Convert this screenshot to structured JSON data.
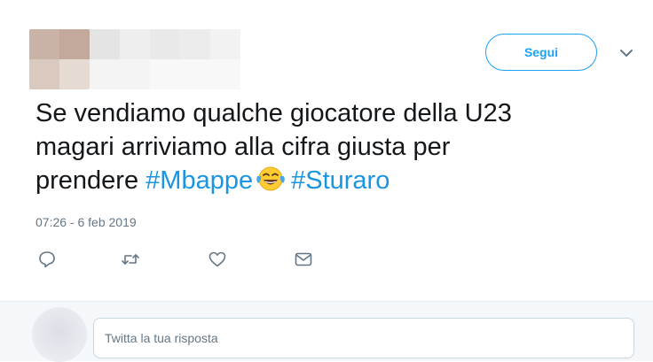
{
  "tweet": {
    "follow_label": "Segui",
    "text_line1": "Se vendiamo qualche giocatore della U23",
    "text_line2": "magari arriviamo alla cifra giusta per",
    "text_line3_prefix": "prendere ",
    "hashtag1": "#Mbappe",
    "emoji": "face-with-tears-of-joy",
    "hashtag2": "#Sturaro",
    "timestamp": "07:26 - 6 feb 2019"
  },
  "actions": {
    "icons": [
      "reply-icon",
      "retweet-icon",
      "like-icon",
      "message-icon"
    ]
  },
  "reply": {
    "placeholder": "Twitta la tua risposta"
  },
  "colors": {
    "accent": "#1da1f2",
    "hashtag": "#1b95e0",
    "muted": "#657786",
    "text": "#14171a"
  }
}
